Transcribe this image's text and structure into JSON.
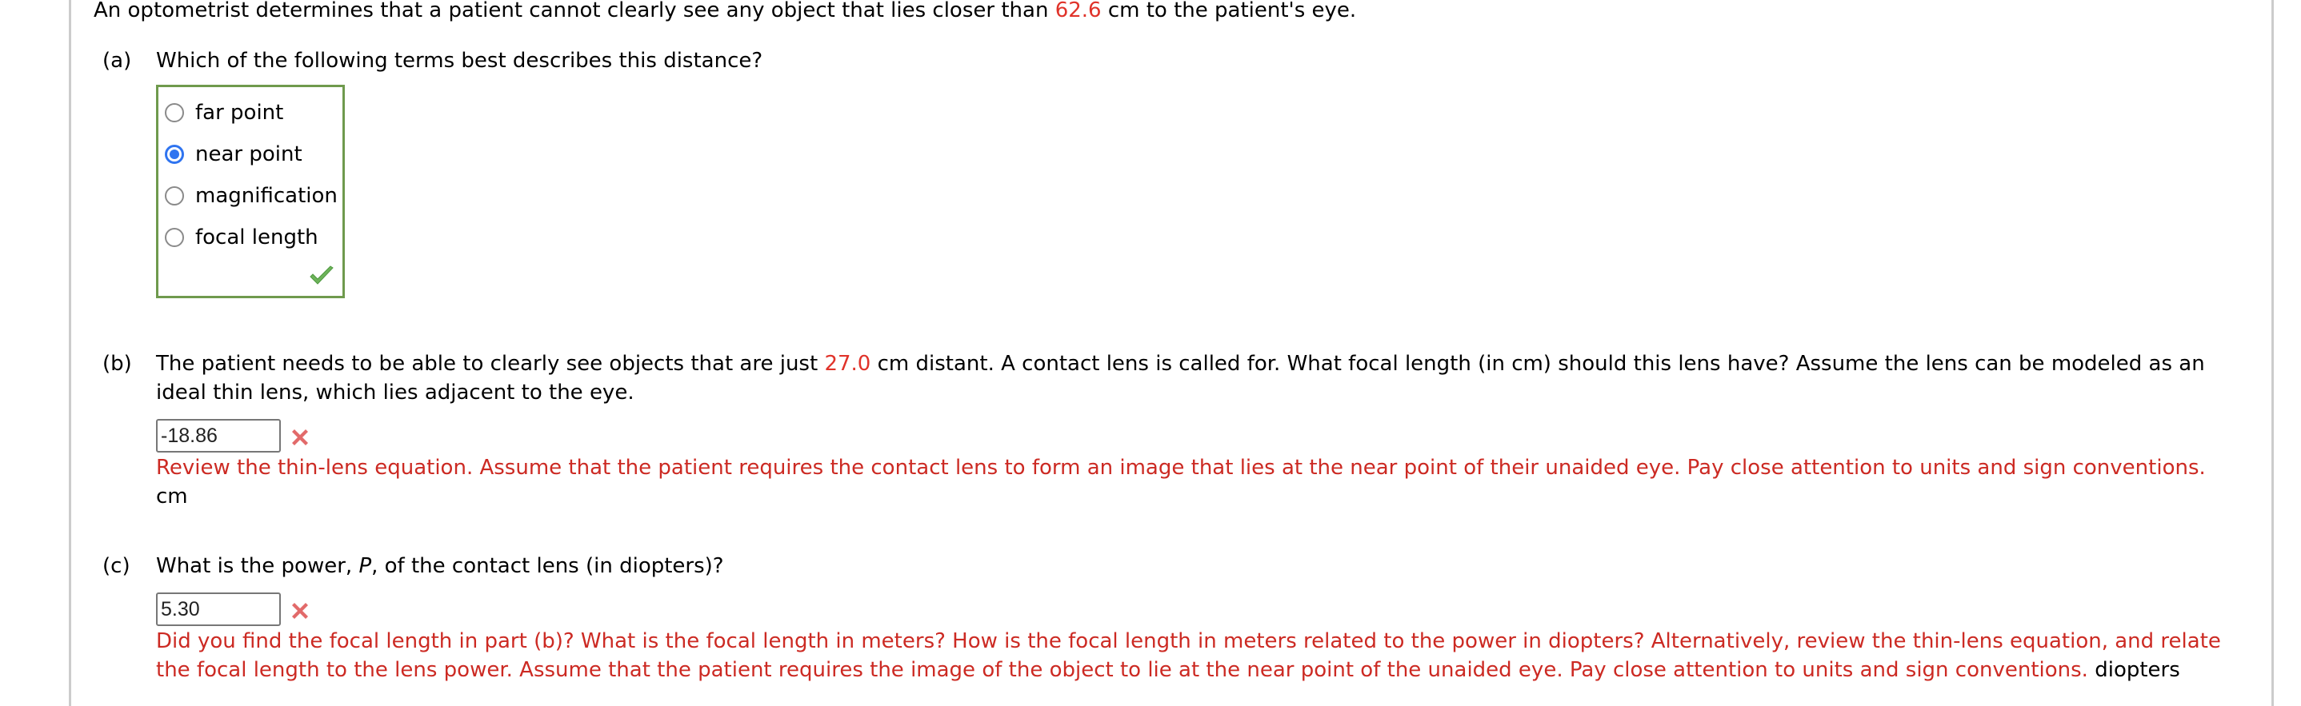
{
  "intro": {
    "before": "An optometrist determines that a patient cannot clearly see any object that lies closer than ",
    "value": "62.6",
    "after": " cm to the patient's eye."
  },
  "part_a": {
    "label": "(a)",
    "question": "Which of the following terms best describes this distance?",
    "options": [
      {
        "label": "far point",
        "selected": false
      },
      {
        "label": "near point",
        "selected": true
      },
      {
        "label": "magnification",
        "selected": false
      },
      {
        "label": "focal length",
        "selected": false
      }
    ],
    "status": "correct",
    "status_icon": "checkmark-icon"
  },
  "part_b": {
    "label": "(b)",
    "question_before": "The patient needs to be able to clearly see objects that are just ",
    "value": "27.0",
    "question_after_line1": " cm distant. A contact lens is called for. What focal length (in cm) should this lens have? Assume the lens can be modeled as an",
    "question_line2": "ideal thin lens, which lies adjacent to the eye.",
    "answer_value": "-18.86",
    "status": "incorrect",
    "status_icon": "x-mark-icon",
    "feedback": "Review the thin-lens equation. Assume that the patient requires the contact lens to form an image that lies at the near point of their unaided eye. Pay close attention to units and sign conventions.",
    "unit": "cm"
  },
  "part_c": {
    "label": "(c)",
    "question_before": "What is the power, ",
    "question_var": "P",
    "question_after": ", of the contact lens (in diopters)?",
    "answer_value": "5.30",
    "status": "incorrect",
    "status_icon": "x-mark-icon",
    "feedback_line1": "Did you find the focal length in part (b)? What is the focal length in meters? How is the focal length in meters related to the power in diopters? Alternatively, review the thin-lens equation, and relate",
    "feedback_line2": "the focal length to the lens power. Assume that the patient requires the image of the object to lie at the near point of the unaided eye. Pay close attention to units and sign conventions.",
    "unit": "diopters"
  },
  "colors": {
    "given_value": "#e0332a",
    "feedback": "#cc2a23",
    "correct_border": "#6f9a4d",
    "radio_selected": "#2f74f0"
  }
}
